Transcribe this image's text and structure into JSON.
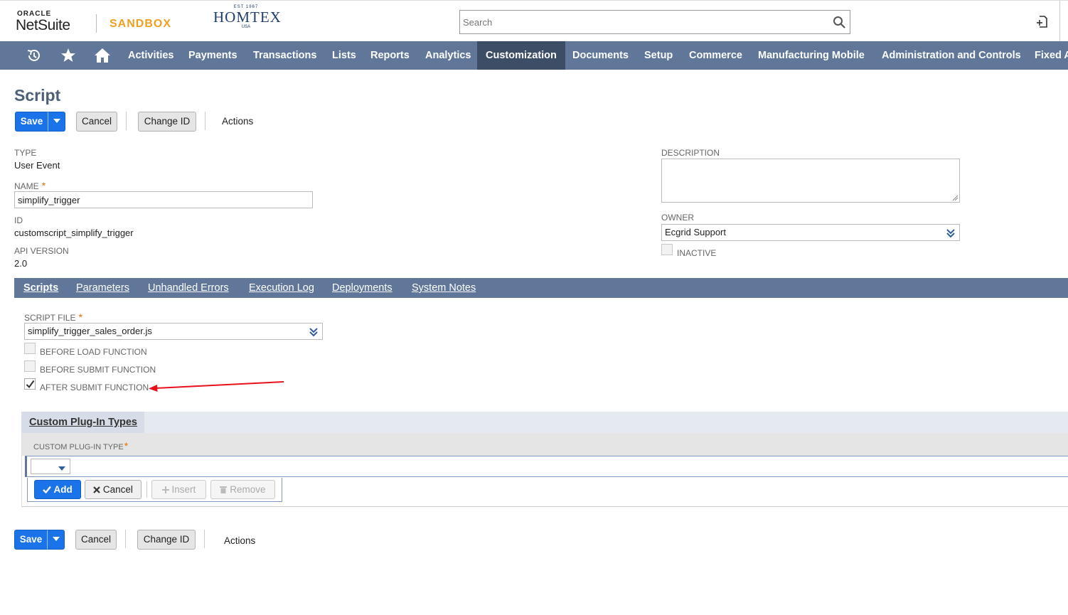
{
  "header": {
    "oracle_label": "ORACLE",
    "netsuite_label": "NetSuite",
    "sandbox_label": "SANDBOX",
    "company_logo": {
      "top": "EST 1967",
      "name": "HOMTEX",
      "bottom": "USA"
    },
    "search_placeholder": "Search"
  },
  "nav": {
    "icons": [
      "recent-records-icon",
      "favorites-star-icon",
      "home-icon"
    ],
    "items": [
      "Activities",
      "Payments",
      "Transactions",
      "Lists",
      "Reports",
      "Analytics",
      "Customization",
      "Documents",
      "Setup",
      "Commerce",
      "Manufacturing Mobile",
      "Administration and Controls",
      "Fixed A"
    ],
    "active": "Customization"
  },
  "page": {
    "title": "Script",
    "buttons": {
      "save": "Save",
      "cancel": "Cancel",
      "change_id": "Change ID",
      "actions": "Actions"
    }
  },
  "fields": {
    "type_label": "TYPE",
    "type_value": "User Event",
    "name_label": "NAME",
    "name_value": "simplify_trigger",
    "id_label": "ID",
    "id_value": "customscript_simplify_trigger",
    "api_label": "API VERSION",
    "api_value": "2.0",
    "description_label": "DESCRIPTION",
    "description_value": "",
    "owner_label": "OWNER",
    "owner_value": "Ecgrid Support",
    "inactive_label": "INACTIVE",
    "inactive_checked": false
  },
  "subtabs": {
    "items": [
      "Scripts",
      "Parameters",
      "Unhandled Errors",
      "Execution Log",
      "Deployments",
      "System Notes"
    ],
    "active": "Scripts"
  },
  "scripts_tab": {
    "script_file_label": "SCRIPT FILE",
    "script_file_value": "simplify_trigger_sales_order.js",
    "before_load_label": "BEFORE LOAD FUNCTION",
    "before_load_checked": false,
    "before_submit_label": "BEFORE SUBMIT FUNCTION",
    "before_submit_checked": false,
    "after_submit_label": "AFTER SUBMIT FUNCTION",
    "after_submit_checked": true
  },
  "plugin_section": {
    "tab_label": "Custom Plug-In Types",
    "column_header": "CUSTOM PLUG-IN TYPE",
    "row_select_value": "",
    "buttons": {
      "add": "Add",
      "cancel": "Cancel",
      "insert": "Insert",
      "remove": "Remove"
    }
  },
  "colors": {
    "navbar": "#607799",
    "nav_active": "#3d4d66",
    "primary_button": "#1a73e8",
    "sandbox": "#f0a020",
    "title": "#4d5f79",
    "required_star": "#e36f00",
    "annotation_arrow": "#e8101a"
  }
}
